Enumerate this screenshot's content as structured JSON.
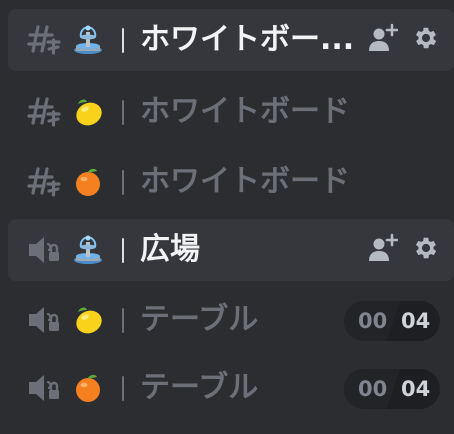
{
  "icons": {
    "text_channel": "hash-threads-icon",
    "voice_channel": "speaker-locked-icon",
    "invite": "add-person-icon",
    "settings": "gear-icon"
  },
  "colors": {
    "background": "#2b2d31",
    "highlight": "#35373c",
    "active_text": "#f2f3f5",
    "muted_text": "#6d6f78"
  },
  "channels": [
    {
      "type": "text",
      "emoji": "fountain",
      "name": "ホワイトボー...",
      "active": true
    },
    {
      "type": "text",
      "emoji": "lemon",
      "name": "ホワイトボード",
      "active": false
    },
    {
      "type": "text",
      "emoji": "tangerine",
      "name": "ホワイトボード",
      "active": false
    },
    {
      "type": "voice",
      "emoji": "fountain",
      "name": "広場",
      "active": true
    },
    {
      "type": "voice",
      "emoji": "lemon",
      "name": "テーブル",
      "active": false,
      "users": "00",
      "limit": "04"
    },
    {
      "type": "voice",
      "emoji": "tangerine",
      "name": "テーブル",
      "active": false,
      "users": "00",
      "limit": "04"
    }
  ]
}
